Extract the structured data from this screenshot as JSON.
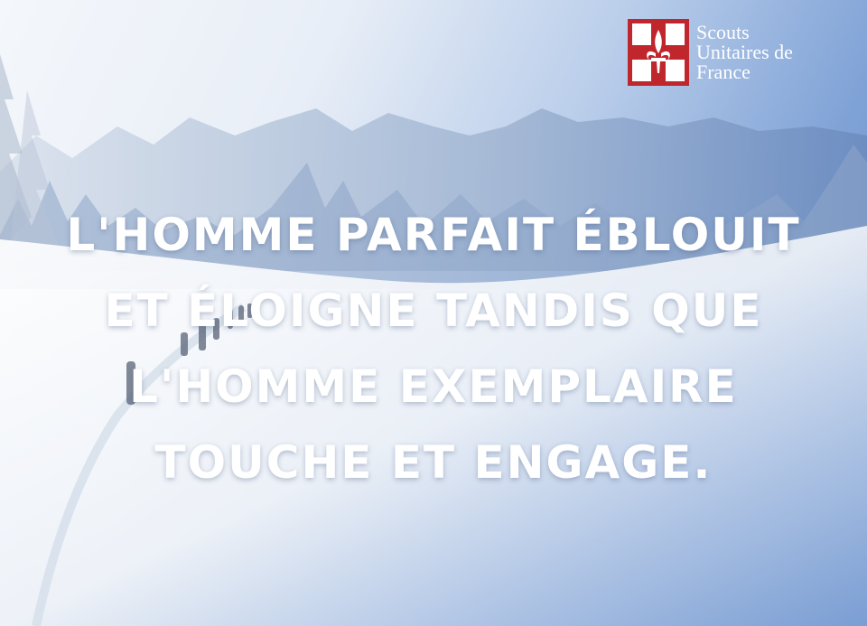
{
  "colors": {
    "sky_light": "#f4f7fb",
    "sky_blue": "#5f88c8",
    "logo_red": "#c0272d",
    "text": "#ffffff"
  },
  "logo": {
    "icon": "scout-cross-fleur-de-lis-icon",
    "line1": "Scouts",
    "line2": "Unitaires de",
    "line3": "France"
  },
  "quote": {
    "line1": "L'homme parfait éblouit",
    "line2": "et éloigne tandis que",
    "line3": "l'homme exemplaire",
    "line4": "touche et engage."
  }
}
